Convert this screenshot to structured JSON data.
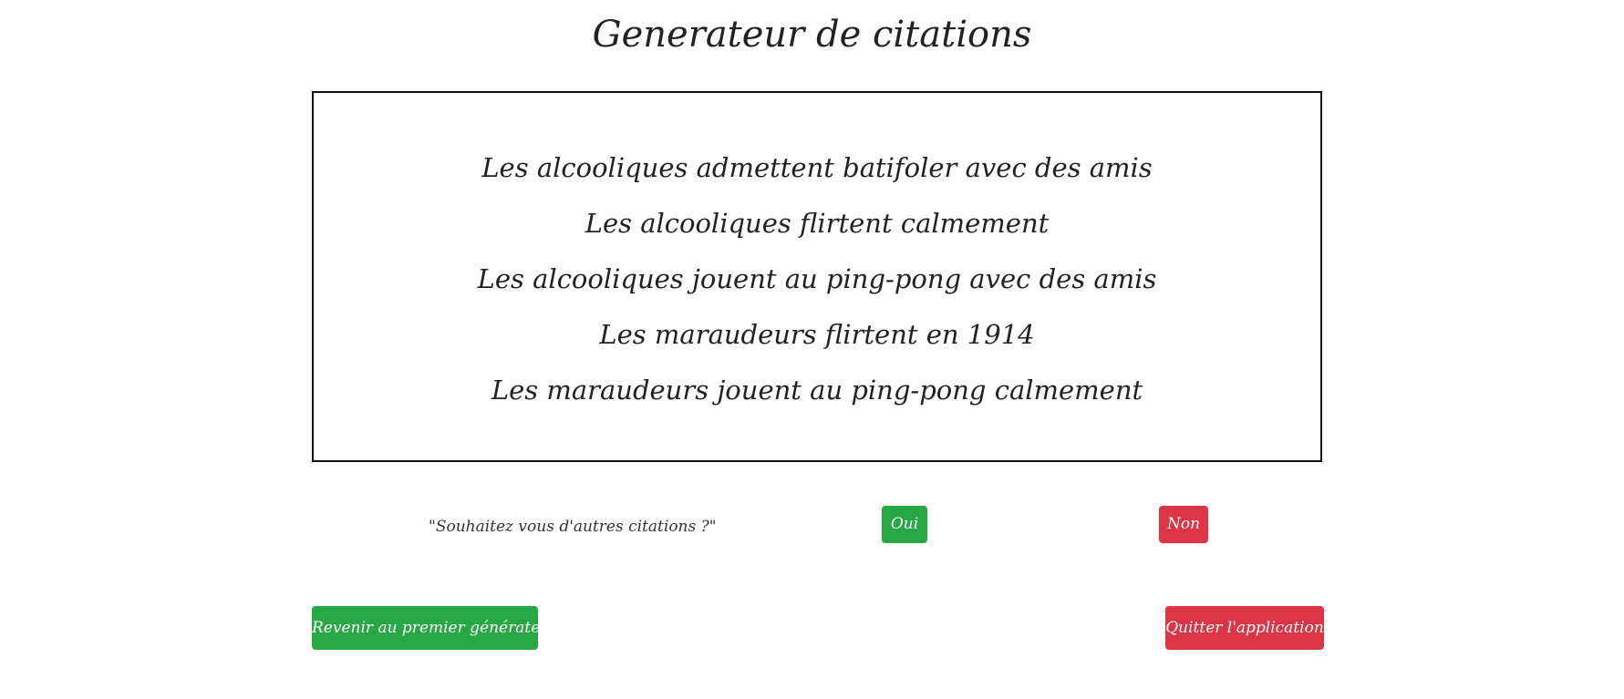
{
  "header": {
    "title": "Generateur de citations"
  },
  "quotes": [
    "Les alcooliques admettent batifoler avec des amis",
    "Les alcooliques flirtent calmement",
    "Les alcooliques jouent au ping-pong avec des amis",
    "Les maraudeurs flirtent en 1914",
    "Les maraudeurs jouent au ping-pong calmement"
  ],
  "prompt": {
    "question": "\"Souhaitez vous d'autres citations ?\"",
    "yes_label": "Oui",
    "no_label": "Non"
  },
  "actions": {
    "back_label": "Revenir au premier générateur",
    "quit_label": "Quitter l'application"
  },
  "colors": {
    "success": "#28a745",
    "danger": "#dc3545",
    "border": "#111111"
  }
}
